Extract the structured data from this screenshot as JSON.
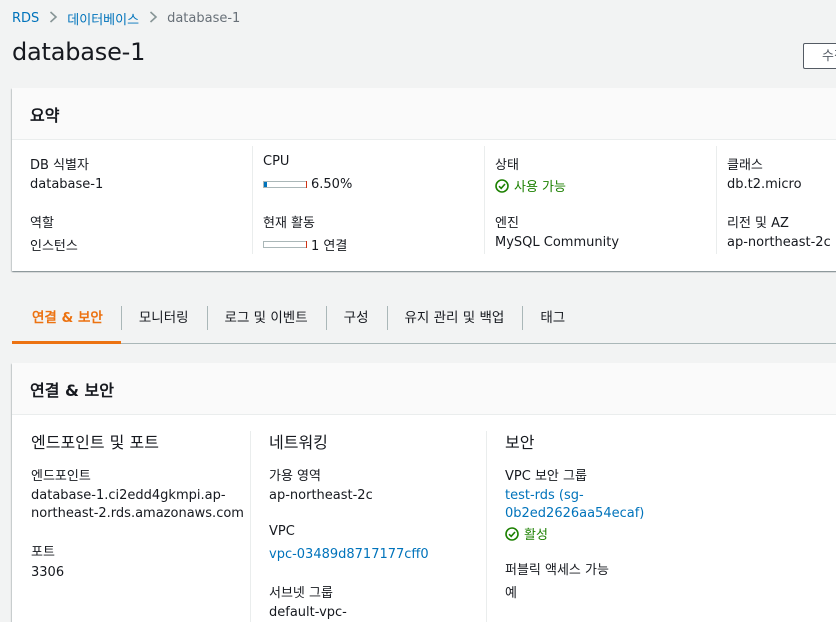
{
  "breadcrumb": {
    "items": [
      "RDS",
      "데이터베이스"
    ],
    "current": "database-1"
  },
  "page": {
    "title": "database-1",
    "top_button_label": "수정"
  },
  "summary": {
    "title": "요약",
    "db_identifier_label": "DB 식별자",
    "db_identifier_value": "database-1",
    "role_label": "역할",
    "role_value": "인스턴스",
    "cpu_label": "CPU",
    "cpu_value": "6.50%",
    "cpu_percent": 6.5,
    "activity_label": "현재 활동",
    "activity_value": "1 연결",
    "activity_percent": 0,
    "status_label": "상태",
    "status_value": "사용 가능",
    "engine_label": "엔진",
    "engine_value": "MySQL Community",
    "class_label": "클래스",
    "class_value": "db.t2.micro",
    "region_label": "리전 및 AZ",
    "region_value": "ap-northeast-2c"
  },
  "tabs": [
    {
      "label": "연결 & 보안",
      "active": true
    },
    {
      "label": "모니터링",
      "active": false
    },
    {
      "label": "로그 및 이벤트",
      "active": false
    },
    {
      "label": "구성",
      "active": false
    },
    {
      "label": "유지 관리 및 백업",
      "active": false
    },
    {
      "label": "태그",
      "active": false
    }
  ],
  "connectivity": {
    "title": "연결 & 보안",
    "endpoint_section": {
      "title": "엔드포인트 및 포트",
      "endpoint_label": "엔드포인트",
      "endpoint_line1": "database-1.ci2edd4gkmpi.ap-",
      "endpoint_line2": "northeast-2.rds.amazonaws.com",
      "port_label": "포트",
      "port_value": "3306"
    },
    "network_section": {
      "title": "네트워킹",
      "az_label": "가용 영역",
      "az_value": "ap-northeast-2c",
      "vpc_label": "VPC",
      "vpc_value": "vpc-03489d8717177cff0",
      "subnet_label": "서브넷 그룹",
      "subnet_value": "default-vpc-"
    },
    "security_section": {
      "title": "보안",
      "sg_label": "VPC 보안 그룹",
      "sg_line1": "test-rds (sg-",
      "sg_line2": "0b2ed2626aa54ecaf)",
      "sg_status": "활성",
      "public_label": "퍼블릭 액세스 가능",
      "public_value": "예"
    }
  },
  "colors": {
    "link": "#0073bb",
    "active_tab": "#ec7211",
    "success": "#1d8102"
  }
}
